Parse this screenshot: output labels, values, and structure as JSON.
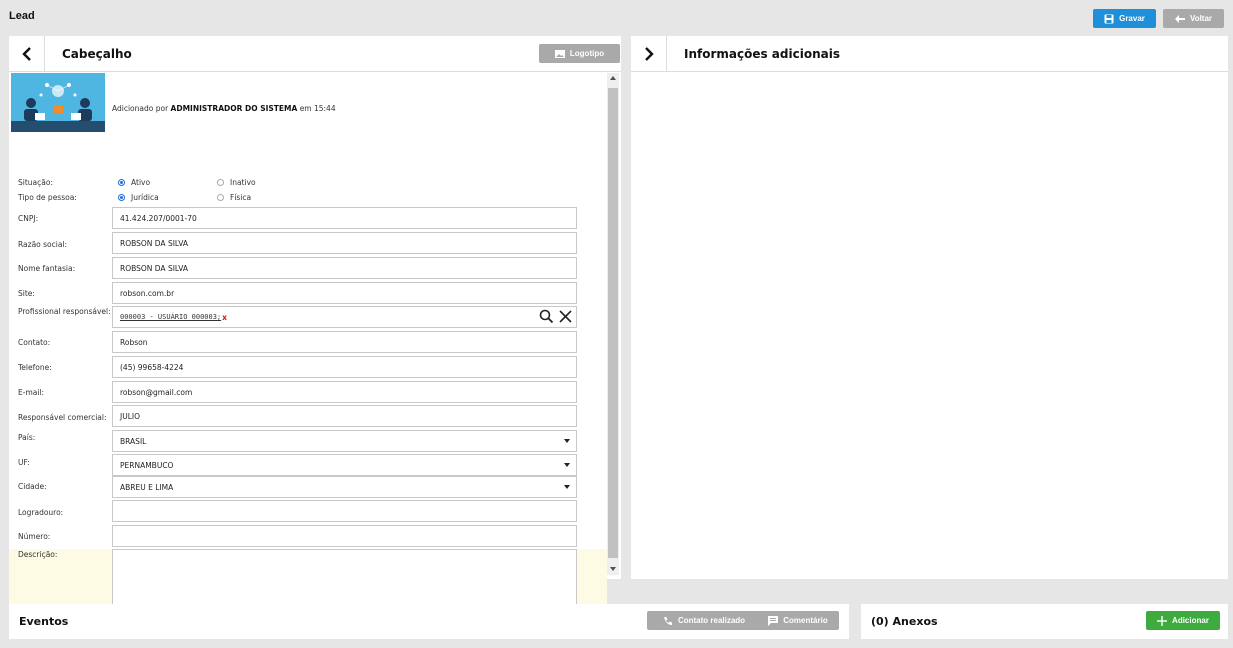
{
  "page": {
    "title": "Lead"
  },
  "toolbar": {
    "save_label": "Gravar",
    "back_label": "Voltar"
  },
  "colors": {
    "primary": "#1e8fd8",
    "secondary": "#a9a9a9",
    "success": "#3eab3e",
    "highlight_row": "#fdfbe3"
  },
  "header_panel": {
    "title": "Cabeçalho",
    "logo_button": "Logotipo",
    "added_prefix": "Adicionado por",
    "added_user": "ADMINISTRADOR DO SISTEMA",
    "added_suffix": "em 15:44"
  },
  "form": {
    "situacao": {
      "label": "Situação:",
      "options": [
        "Ativo",
        "Inativo"
      ],
      "selected": "Ativo"
    },
    "tipo_pessoa": {
      "label": "Tipo de pessoa:",
      "options": [
        "Jurídica",
        "Física"
      ],
      "selected": "Jurídica"
    },
    "cnpj": {
      "label": "CNPJ:",
      "value": "41.424.207/0001-70"
    },
    "razao_social": {
      "label": "Razão social:",
      "value": "ROBSON DA SILVA"
    },
    "nome_fantasia": {
      "label": "Nome fantasia:",
      "value": "ROBSON DA SILVA"
    },
    "site": {
      "label": "Site:",
      "value": "robson.com.br"
    },
    "profissional": {
      "label": "Profissional responsável:",
      "value": "000003 - USUÁRIO 000003;",
      "remove": "x"
    },
    "contato": {
      "label": "Contato:",
      "value": "Robson"
    },
    "telefone": {
      "label": "Telefone:",
      "value": "(45) 99658-4224"
    },
    "email": {
      "label": "E-mail:",
      "value": "robson@gmail.com"
    },
    "resp_comercial": {
      "label": "Responsável comercial:",
      "value": "JULIO"
    },
    "pais": {
      "label": "País:",
      "value": "BRASIL"
    },
    "uf": {
      "label": "UF:",
      "value": "PERNAMBUCO"
    },
    "cidade": {
      "label": "Cidade:",
      "value": "ABREU E LIMA"
    },
    "logradouro": {
      "label": "Logradouro:",
      "value": ""
    },
    "numero": {
      "label": "Número:",
      "value": ""
    },
    "descricao": {
      "label": "Descrição:",
      "value": ""
    }
  },
  "right_panel": {
    "title": "Informações adicionais"
  },
  "events": {
    "title": "Eventos",
    "contact_button": "Contato realizado",
    "comment_button": "Comentário"
  },
  "attachments": {
    "title": "(0) Anexos",
    "add_button": "Adicionar"
  }
}
